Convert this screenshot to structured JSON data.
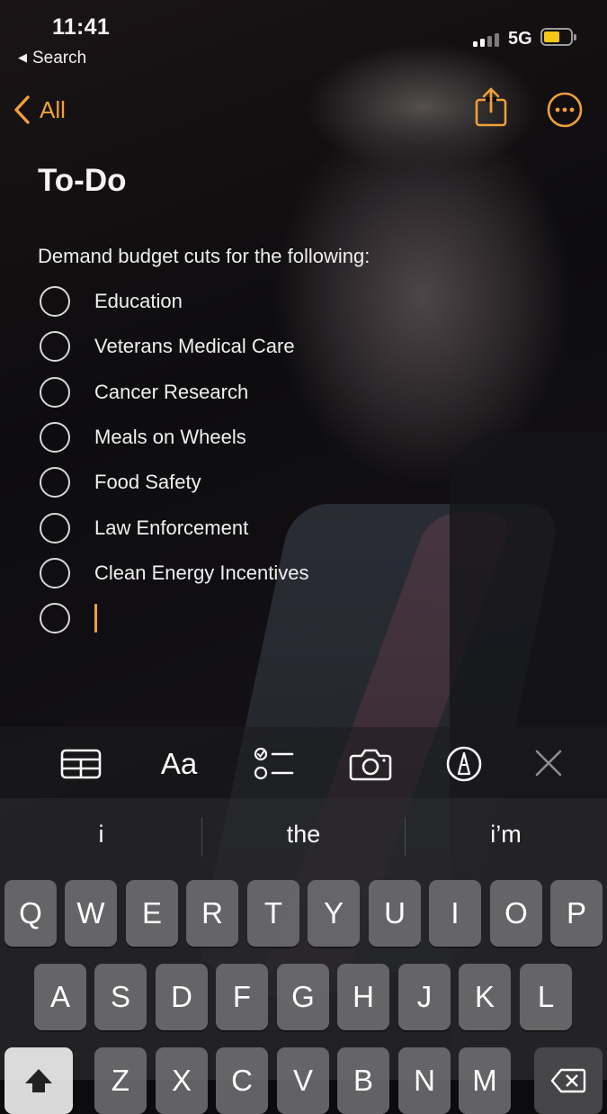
{
  "status": {
    "time": "11:41",
    "back_app": "Search",
    "network": "5G"
  },
  "nav": {
    "back_label": "All"
  },
  "note": {
    "title": "To-Do",
    "intro": "Demand budget cuts for the following:",
    "items": [
      "Education",
      "Veterans Medical Care",
      "Cancer Research",
      "Meals on Wheels",
      "Food Safety",
      "Law Enforcement",
      "Clean Energy Incentives"
    ]
  },
  "toolbar": {
    "table_icon": "table-icon",
    "format_label": "Aa",
    "checklist_icon": "checklist-icon",
    "camera_icon": "camera-icon",
    "markup_icon": "markup-pen-icon",
    "close_icon": "close-icon"
  },
  "keyboard": {
    "suggestions": [
      "i",
      "the",
      "i’m"
    ],
    "row1": [
      "Q",
      "W",
      "E",
      "R",
      "T",
      "Y",
      "U",
      "I",
      "O",
      "P"
    ],
    "row2": [
      "A",
      "S",
      "D",
      "F",
      "G",
      "H",
      "J",
      "K",
      "L"
    ],
    "row3": [
      "Z",
      "X",
      "C",
      "V",
      "B",
      "N",
      "M"
    ]
  },
  "colors": {
    "accent": "#f0a03a",
    "battery": "#f5c518"
  }
}
